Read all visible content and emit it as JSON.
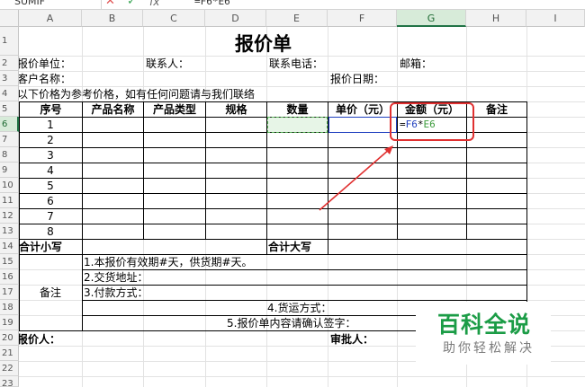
{
  "formula_bar": {
    "name_box": "SUMIF",
    "cancel_icon": "✕",
    "enter_icon": "✓",
    "fx_label": "fx",
    "formula": "=F6*E6"
  },
  "columns": [
    "A",
    "B",
    "C",
    "D",
    "E",
    "F",
    "G",
    "H",
    "I"
  ],
  "rows": [
    "1",
    "2",
    "3",
    "4",
    "5",
    "6",
    "7",
    "8",
    "9",
    "10",
    "11",
    "12",
    "13",
    "14",
    "15",
    "16",
    "17",
    "18",
    "19",
    "20",
    "21",
    "22",
    "23"
  ],
  "sheet": {
    "title": "报价单",
    "quote_unit_label": "报价单位：",
    "contact_label": "联系人：",
    "phone_label": "联系电话：",
    "email_label": "邮箱：",
    "customer_label": "客户名称：",
    "quote_date_label": "报价日期：",
    "note_line": "以下价格为参考价格，如有任何问题请与我们联络",
    "headers": [
      "序号",
      "产品名称",
      "产品类型",
      "规格",
      "数量",
      "单价（元）",
      "金额（元）",
      "备注"
    ],
    "item_numbers": [
      "1",
      "2",
      "3",
      "4",
      "5",
      "6",
      "7",
      "8"
    ],
    "active_formula": "=F6*E6",
    "total_small_label": "合计小写",
    "total_big_label": "合计大写",
    "remarks_label": "备注",
    "remarks": [
      "1.本报价有效期#天，供货期#天。",
      "2.交货地址：",
      "3.付款方式：",
      "4.货运方式：",
      "5.报价单内容请确认签字："
    ],
    "quoter_label": "报价人：",
    "approver_label": "审批人："
  },
  "watermark": {
    "title": "百科全说",
    "subtitle": "助你轻松解决"
  },
  "colors": {
    "selection_green": "#5cb85c",
    "reference_blue": "#1f3fbf",
    "highlight_red": "#e03030",
    "brand_green": "#1b9c46"
  }
}
